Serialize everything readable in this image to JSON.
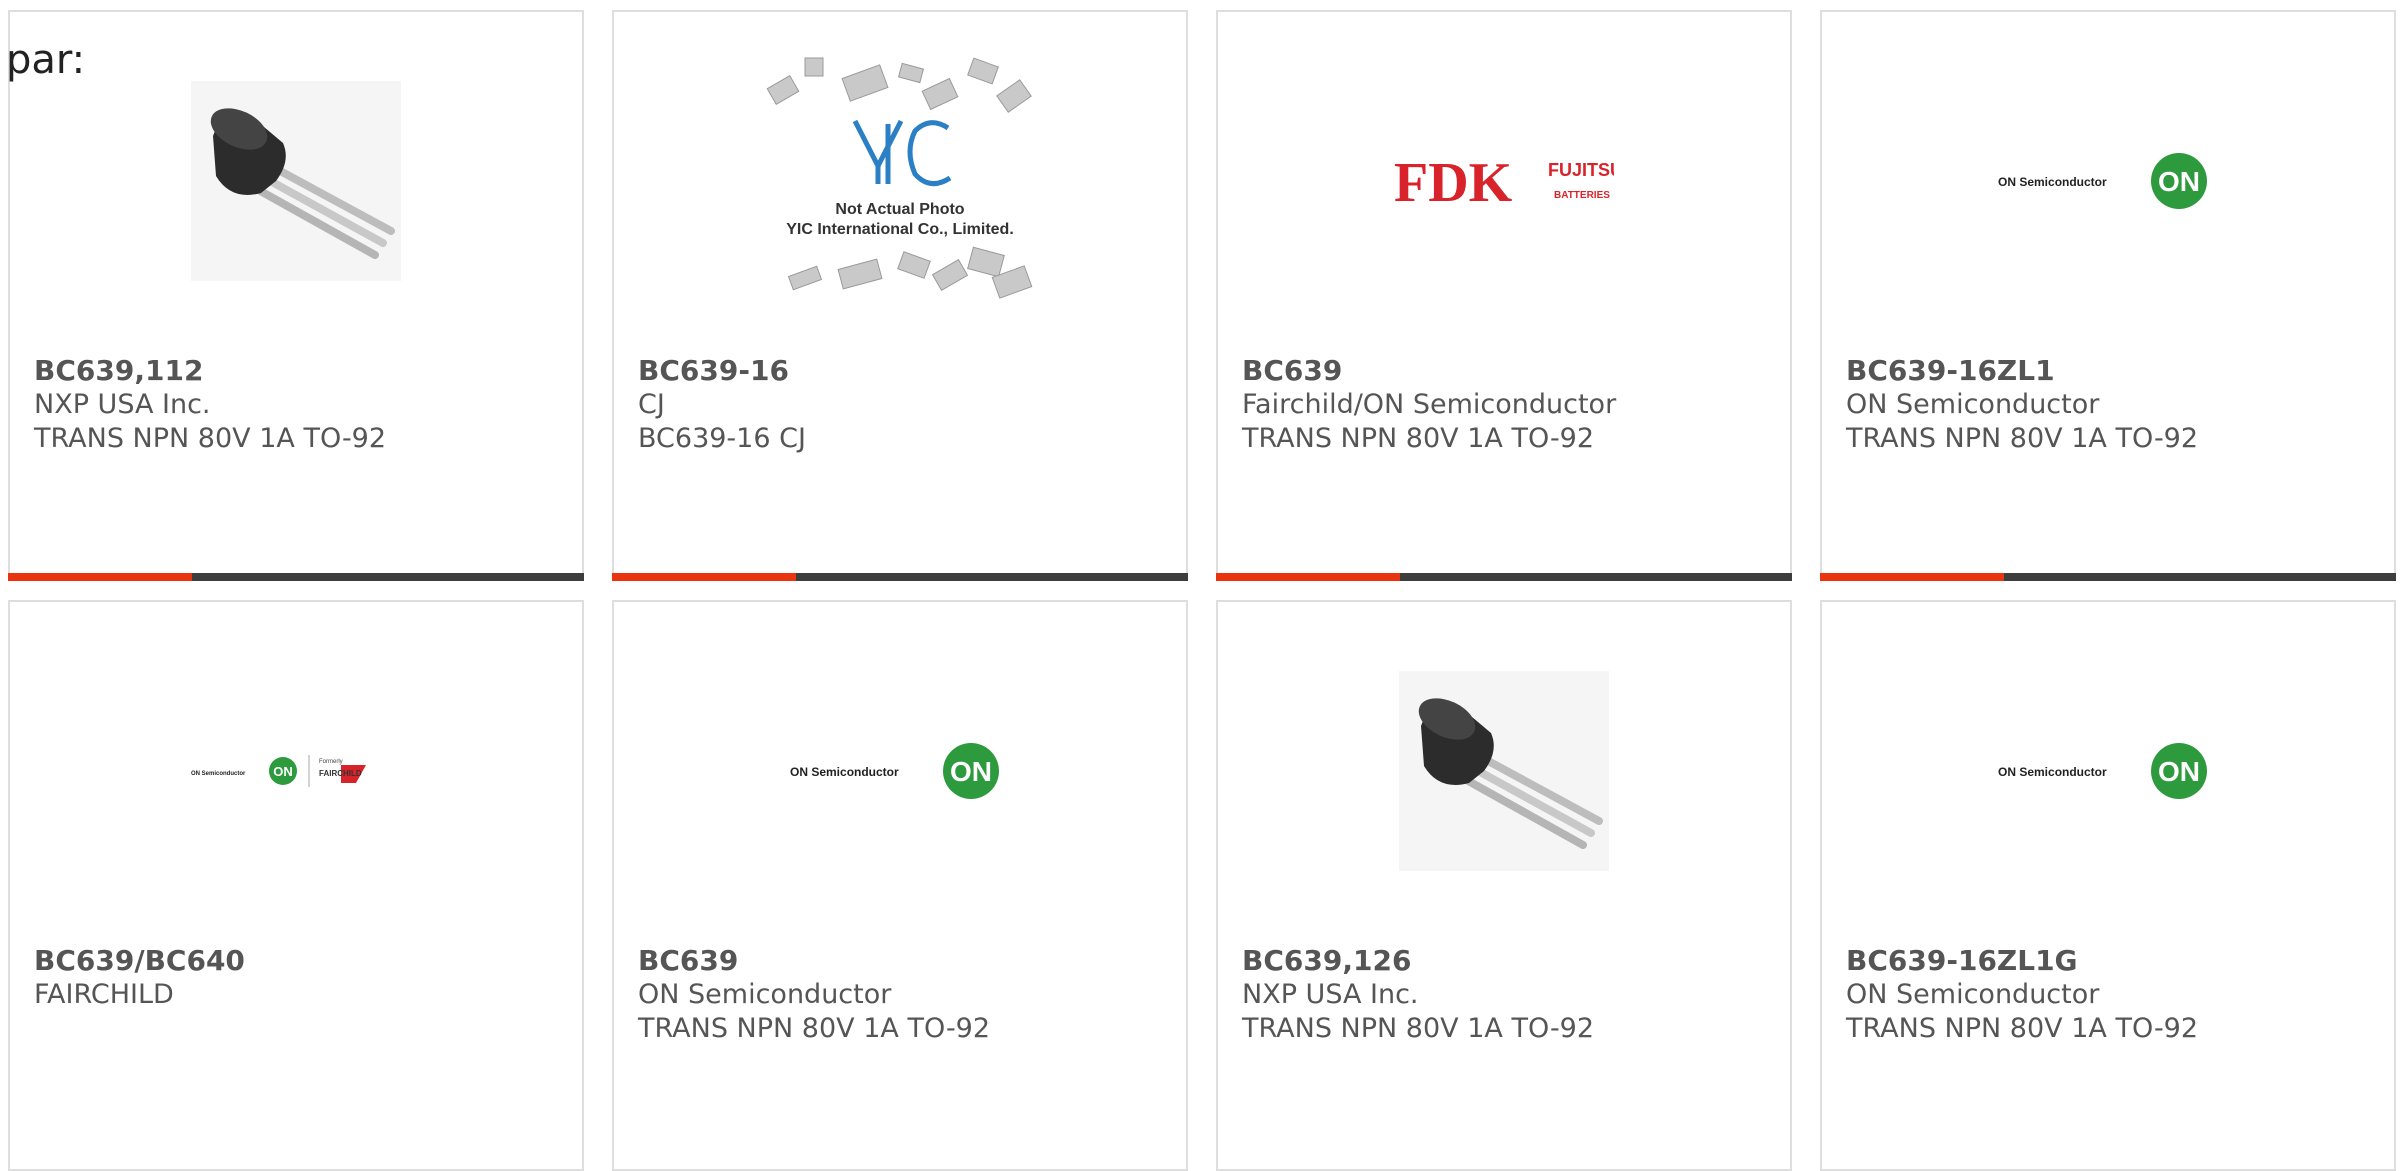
{
  "intro": "par:",
  "cards": [
    {
      "part": "BC639,112",
      "manufacturer": "NXP USA Inc.",
      "description": "TRANS NPN 80V 1A TO-92",
      "image": "to92-transistor-photo"
    },
    {
      "part": "BC639-16",
      "manufacturer": "CJ",
      "description": "BC639-16 CJ",
      "image": "yic-placeholder",
      "image_text": {
        "logo": "YIC",
        "line1": "Not Actual Photo",
        "line2": "YIC International Co., Limited."
      }
    },
    {
      "part": "BC639",
      "manufacturer": "Fairchild/ON Semiconductor",
      "description": "TRANS NPN 80V 1A TO-92",
      "image": "fdk-fujitsu-logo",
      "image_text": {
        "main": "FDK",
        "sub1": "FUJITSU",
        "sub2": "BATTERIES"
      }
    },
    {
      "part": "BC639-16ZL1",
      "manufacturer": "ON Semiconductor",
      "description": "TRANS NPN 80V 1A TO-92",
      "image": "on-semiconductor-logo",
      "image_text": {
        "name": "ON Semiconductor",
        "badge": "ON"
      }
    },
    {
      "part": "BC639/BC640",
      "manufacturer": "FAIRCHILD",
      "description": "",
      "image": "on-fairchild-logo",
      "image_text": {
        "name": "ON Semiconductor",
        "badge": "ON",
        "formerly": "Formerly",
        "fairchild": "FAIRCHILD"
      }
    },
    {
      "part": "BC639",
      "manufacturer": "ON Semiconductor",
      "description": "TRANS NPN 80V 1A TO-92",
      "image": "on-semiconductor-logo",
      "image_text": {
        "name": "ON Semiconductor",
        "badge": "ON"
      }
    },
    {
      "part": "BC639,126",
      "manufacturer": "NXP USA Inc.",
      "description": "TRANS NPN 80V 1A TO-92",
      "image": "to92-transistor-photo"
    },
    {
      "part": "BC639-16ZL1G",
      "manufacturer": "ON Semiconductor",
      "description": "TRANS NPN 80V 1A TO-92",
      "image": "on-semiconductor-logo",
      "image_text": {
        "name": "ON Semiconductor",
        "badge": "ON"
      }
    }
  ],
  "colors": {
    "accent": "#e8350f",
    "bar": "#3d3d3d",
    "border": "#dedede",
    "text": "#555555",
    "on_green": "#2e9a3e",
    "fdk_red": "#d8232a"
  }
}
